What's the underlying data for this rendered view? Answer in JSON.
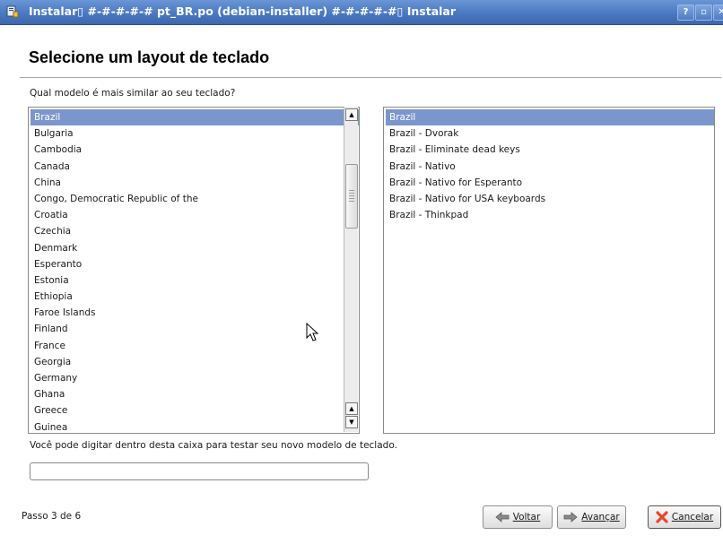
{
  "window": {
    "title": "Instalar▯ #-#-#-#-#  pt_BR.po (debian-installer)  #-#-#-#-#▯ Instalar",
    "help_label": "?",
    "maximize_label": "▫",
    "close_label": "✕"
  },
  "page": {
    "heading": "Selecione um layout de teclado",
    "question": "Qual modelo é mais similar ao seu teclado?",
    "test_hint": "Você pode digitar dentro desta caixa para testar seu novo modelo de teclado.",
    "test_input_value": "",
    "step": "Passo 3 de 6"
  },
  "models": {
    "selected": "Brazil",
    "items": [
      "Brazil",
      "Bulgaria",
      "Cambodia",
      "Canada",
      "China",
      "Congo, Democratic Republic of the",
      "Croatia",
      "Czechia",
      "Denmark",
      "Esperanto",
      "Estonia",
      "Ethiopia",
      "Faroe Islands",
      "Finland",
      "France",
      "Georgia",
      "Germany",
      "Ghana",
      "Greece",
      "Guinea"
    ]
  },
  "variants": {
    "selected": "Brazil",
    "items": [
      "Brazil",
      "Brazil - Dvorak",
      "Brazil - Eliminate dead keys",
      "Brazil - Nativo",
      "Brazil - Nativo for Esperanto",
      "Brazil - Nativo for USA keyboards",
      "Brazil - Thinkpad"
    ]
  },
  "buttons": {
    "back": "Voltar",
    "next": "Avançar",
    "cancel": "Cancelar"
  },
  "icons": {
    "app": "installer-icon",
    "back": "arrow-left-icon",
    "next": "arrow-right-icon",
    "cancel": "cancel-x-icon"
  },
  "colors": {
    "titlebar": "#4a78c2",
    "selection": "#7a96cc",
    "cancel_icon": "#e8452c"
  }
}
